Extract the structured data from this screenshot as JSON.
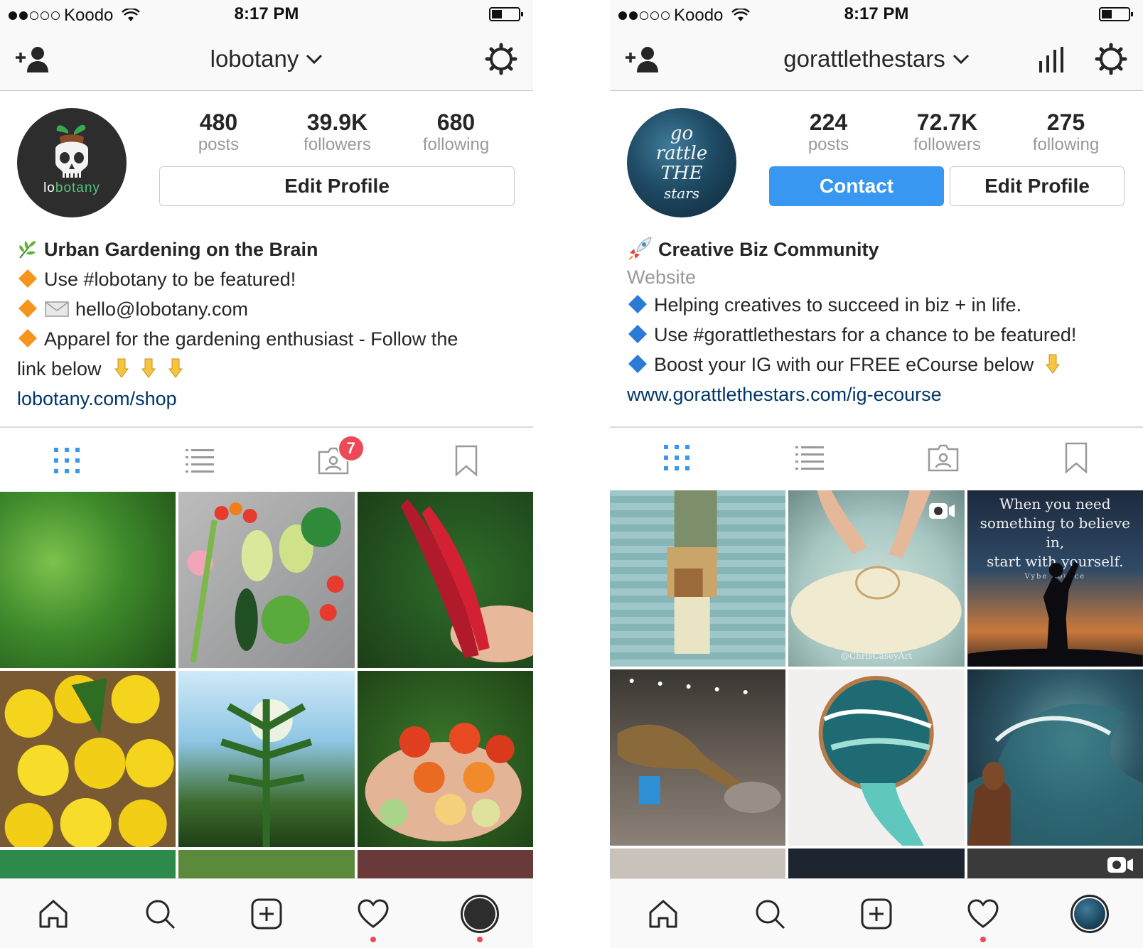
{
  "status_bar": {
    "carrier": "Koodo",
    "time": "8:17 PM"
  },
  "left": {
    "username": "lobotany",
    "avatar_text_a": "lo",
    "avatar_text_b": "botany",
    "stats": [
      {
        "value": "480",
        "label": "posts"
      },
      {
        "value": "39.9K",
        "label": "followers"
      },
      {
        "value": "680",
        "label": "following"
      }
    ],
    "edit_profile": "Edit Profile",
    "bio_name": "Urban Gardening on the Brain",
    "bio_lines": [
      "Use #lobotany to be featured!",
      "hello@lobotany.com",
      "Apparel for the gardening enthusiast - Follow the",
      "link below"
    ],
    "bio_link": "lobotany.com/shop",
    "tagged_badge": "7"
  },
  "right": {
    "username": "gorattlethestars",
    "avatar_lines": [
      "go",
      "rattle",
      "THE",
      "stars"
    ],
    "stats": [
      {
        "value": "224",
        "label": "posts"
      },
      {
        "value": "72.7K",
        "label": "followers"
      },
      {
        "value": "275",
        "label": "following"
      }
    ],
    "contact": "Contact",
    "edit_profile": "Edit Profile",
    "bio_name": "Creative Biz Community",
    "bio_category": "Website",
    "bio_lines": [
      "Helping creatives to succeed in biz + in life.",
      "Use #gorattlethestars for a chance to be featured!",
      "Boost your IG with our FREE eCourse below"
    ],
    "bio_link": "www.gorattlethestars.com/ig-ecourse",
    "quote_line_1": "When you need",
    "quote_line_2": "something to believe in,",
    "quote_line_3": "start with yourself.",
    "quote_source": "Vybe Source",
    "credit": "@ChrisCaseyArt"
  },
  "colors": {
    "accent_blue": "#3897f0",
    "link": "#003569",
    "notification_red": "#ed4956",
    "muted_text": "#999999"
  },
  "icons": {
    "nav": [
      "add-user-icon",
      "chevron-down-icon",
      "insights-icon",
      "gear-icon"
    ],
    "tabs": [
      "grid-icon",
      "list-icon",
      "tagged-icon",
      "bookmark-icon"
    ],
    "bottom": [
      "home-icon",
      "search-icon",
      "add-post-icon",
      "heart-icon",
      "profile-avatar"
    ]
  }
}
